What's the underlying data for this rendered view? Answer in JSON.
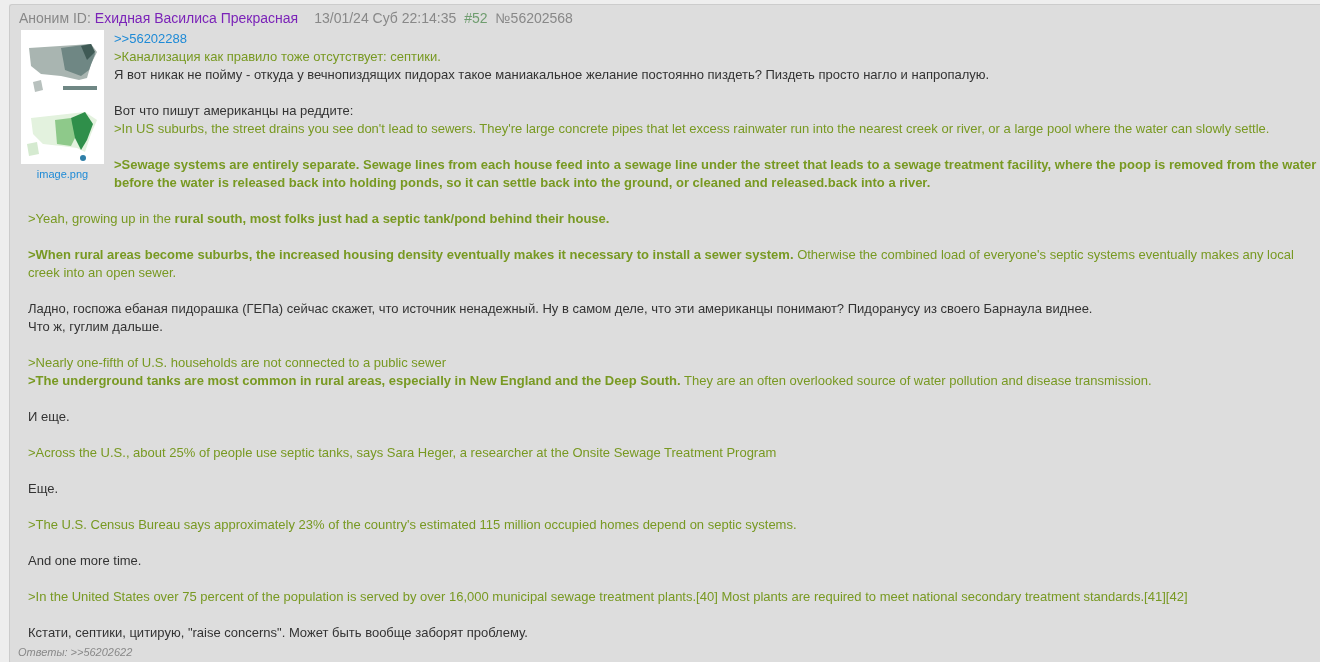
{
  "post": {
    "author": "Аноним ID:",
    "poster_name": "Ехидная Василиса Прекрасная",
    "datetime": "13/01/24 Суб 22:14:35",
    "number": "#52",
    "post_id": "№56202568",
    "attachment": {
      "kind": "picture",
      "filename": "image.png"
    },
    "blocks": [
      {
        "lines": [
          {
            "kind": "reply_link",
            "bold": false,
            "text": ">>56202288"
          },
          {
            "kind": "quote",
            "bold": false,
            "text": ">Канализация как правило тоже отсутствует: септики."
          },
          {
            "kind": "text",
            "bold": false,
            "text": "Я вот никак не пойму - откуда у вечнопиздящих пидорах такое маниакальное желание постоянно пиздеть? Пиздеть просто нагло и напропалую."
          }
        ]
      },
      {
        "lines": [
          {
            "kind": "text",
            "bold": false,
            "text": "Вот что пишут американцы на реддите:"
          },
          {
            "kind": "quote",
            "bold": false,
            "text": ">In US suburbs, the street drains you see don't lead to sewers. They're large concrete pipes that let excess rainwater run into the nearest creek or river, or a large pool where the water can slowly settle."
          }
        ]
      },
      {
        "lines": [
          {
            "kind": "quote",
            "bold": true,
            "text": ">Sewage systems are entirely separate. Sewage lines from each house feed into a sewage line under the street that leads to a sewage treatment facility, where the poop is removed from the water before the water is released back into holding ponds, so it can settle back into the ground, or cleaned and released.back into a river."
          }
        ]
      },
      {
        "lines": [
          {
            "kind": "quote",
            "bold": false,
            "text": ">Yeah, growing up in the **rural south, most folks just had a septic tank/pond behind their house.**"
          }
        ]
      },
      {
        "lines": [
          {
            "kind": "quote",
            "bold": false,
            "text": "**>When rural areas become suburbs, the increased housing density eventually makes it necessary to install a sewer system.** Otherwise the combined load of everyone's septic systems eventually makes any local creek into an open sewer."
          }
        ]
      },
      {
        "lines": [
          {
            "kind": "text",
            "bold": false,
            "text": "Ладно, госпожа ебаная пидорашка (ГЕПа) сейчас скажет, что источник ненадежный. Ну в самом деле, что эти американцы понимают? Пидоранусу из своего Барнаула виднее."
          },
          {
            "kind": "text",
            "bold": false,
            "text": "Что ж, гуглим дальше."
          }
        ]
      },
      {
        "lines": [
          {
            "kind": "quote",
            "bold": false,
            "text": ">Nearly one-fifth of U.S. households are not connected to a public sewer"
          },
          {
            "kind": "quote",
            "bold": false,
            "text": "**>The underground tanks are most common in rural areas, especially in New England and the Deep South.** They are an often overlooked source of water pollution and disease transmission."
          }
        ]
      },
      {
        "lines": [
          {
            "kind": "text",
            "bold": false,
            "text": "И еще."
          }
        ]
      },
      {
        "lines": [
          {
            "kind": "quote",
            "bold": false,
            "text": ">Across the U.S., about 25% of people use septic tanks, says Sara Heger, a researcher at the Onsite Sewage Treatment Program"
          }
        ]
      },
      {
        "lines": [
          {
            "kind": "text",
            "bold": false,
            "text": "Еще."
          }
        ]
      },
      {
        "lines": [
          {
            "kind": "quote",
            "bold": false,
            "text": ">The U.S. Census Bureau says approximately 23% of the country's estimated 115 million occupied homes depend on septic systems."
          }
        ]
      },
      {
        "lines": [
          {
            "kind": "text",
            "bold": false,
            "text": "And one more time."
          }
        ]
      },
      {
        "lines": [
          {
            "kind": "quote",
            "bold": false,
            "text": ">In the United States over 75 percent of the population is served by over 16,000 municipal sewage treatment plants.[40] Most plants are required to meet national secondary treatment standards.[41][42]"
          }
        ]
      },
      {
        "lines": [
          {
            "kind": "text",
            "bold": false,
            "text": "Кстати, септики, цитирую, \"raise concerns\". Может быть вообще заборят проблему."
          }
        ]
      }
    ],
    "replies_label": "Ответы:",
    "replies": [
      ">>56202622"
    ]
  }
}
